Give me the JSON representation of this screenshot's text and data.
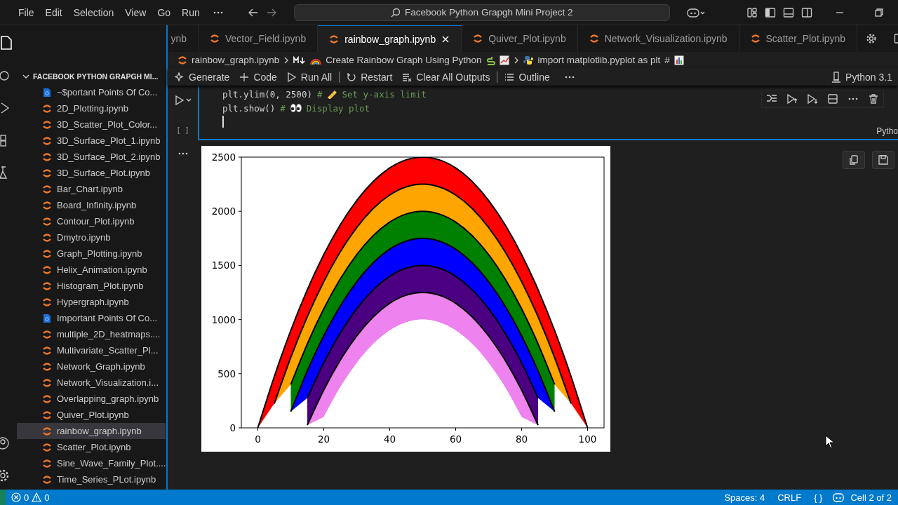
{
  "menu": [
    "File",
    "Edit",
    "Selection",
    "View",
    "Go",
    "Run"
  ],
  "title_search": "Facebook Python Grapgh Mini Project 2",
  "tabs": [
    {
      "label": "ynb",
      "selected": false
    },
    {
      "label": "Vector_Field.ipynb",
      "selected": false
    },
    {
      "label": "rainbow_graph.ipynb",
      "selected": true
    },
    {
      "label": "Quiver_Plot.ipynb",
      "selected": false
    },
    {
      "label": "Network_Visualization.ipynb",
      "selected": false
    },
    {
      "label": "Scatter_Plot.ipynb",
      "selected": false
    }
  ],
  "sidebar": {
    "title": "FACEBOOK PYTHON GRAPGH MI...",
    "items": [
      {
        "name": "~$portant Points Of Co...",
        "kind": "document",
        "selected": false
      },
      {
        "name": "2D_Plotting.ipynb",
        "kind": "notebook",
        "selected": false
      },
      {
        "name": "3D_Scatter_Plot_Color...",
        "kind": "notebook",
        "selected": false
      },
      {
        "name": "3D_Surface_Plot_1.ipynb",
        "kind": "notebook",
        "selected": false
      },
      {
        "name": "3D_Surface_Plot_2.ipynb",
        "kind": "notebook",
        "selected": false
      },
      {
        "name": "3D_Surface_Plot.ipynb",
        "kind": "notebook",
        "selected": false
      },
      {
        "name": "Bar_Chart.ipynb",
        "kind": "notebook",
        "selected": false
      },
      {
        "name": "Board_Infinity.ipynb",
        "kind": "notebook",
        "selected": false
      },
      {
        "name": "Contour_Plot.ipynb",
        "kind": "notebook",
        "selected": false
      },
      {
        "name": "Dmytro.ipynb",
        "kind": "notebook",
        "selected": false
      },
      {
        "name": "Graph_Plotting.ipynb",
        "kind": "notebook",
        "selected": false
      },
      {
        "name": "Helix_Animation.ipynb",
        "kind": "notebook",
        "selected": false
      },
      {
        "name": "Histogram_Plot.ipynb",
        "kind": "notebook",
        "selected": false
      },
      {
        "name": "Hypergraph.ipynb",
        "kind": "notebook",
        "selected": false
      },
      {
        "name": "Important Points Of Co...",
        "kind": "document",
        "selected": false
      },
      {
        "name": "multiple_2D_heatmaps....",
        "kind": "notebook",
        "selected": false
      },
      {
        "name": "Multivariate_Scatter_Pl...",
        "kind": "notebook",
        "selected": false
      },
      {
        "name": "Network_Graph.ipynb",
        "kind": "notebook",
        "selected": false
      },
      {
        "name": "Network_Visualization.i...",
        "kind": "notebook",
        "selected": false
      },
      {
        "name": "Overlapping_graph.ipynb",
        "kind": "notebook",
        "selected": false
      },
      {
        "name": "Quiver_Plot.ipynb",
        "kind": "notebook",
        "selected": false
      },
      {
        "name": "rainbow_graph.ipynb",
        "kind": "notebook",
        "selected": true
      },
      {
        "name": "Scatter_Plot.ipynb",
        "kind": "notebook",
        "selected": false
      },
      {
        "name": "Sine_Wave_Family_Plot....",
        "kind": "notebook",
        "selected": false
      },
      {
        "name": "Time_Series_PLot.ipynb",
        "kind": "notebook",
        "selected": false
      }
    ]
  },
  "breadcrumb": {
    "file": "rainbow_graph.ipynb",
    "cell": "Create Rainbow Graph Using Python",
    "code": "import matplotlib.pyplot as plt",
    "comment_mark": "#"
  },
  "toolbar": {
    "items": [
      "Generate",
      "Code",
      "Run All",
      "Restart",
      "Clear All Outputs",
      "Outline"
    ],
    "kernel": "Python 3.1"
  },
  "cell": {
    "lines": [
      {
        "code": "plt.ylim(0, 2500)",
        "comment_mark": "#",
        "kind": "ruler",
        "comment": "Set y-axis limit"
      },
      {
        "code": "plt.show()",
        "comment_mark": "#",
        "kind": "eyes",
        "comment": "Display plot"
      }
    ],
    "exec_count": "[ ]",
    "language": "Pytho"
  },
  "output": {
    "chart_data": {
      "type": "area",
      "x": [
        0,
        5,
        10,
        15,
        20,
        25,
        30,
        35,
        40,
        45,
        50,
        55,
        60,
        65,
        70,
        75,
        80,
        85,
        90,
        95,
        100
      ],
      "xlim": [
        -5,
        105
      ],
      "ylim": [
        0,
        2500
      ],
      "xticks": [
        0,
        20,
        40,
        60,
        80,
        100
      ],
      "yticks": [
        0,
        500,
        1000,
        1500,
        2000,
        2500
      ],
      "stacked": false,
      "series": [
        {
          "color": "#ff0000",
          "values": [
            0,
            475,
            900,
            1275,
            1600,
            1875,
            2100,
            2275,
            2400,
            2475,
            2500,
            2475,
            2400,
            2275,
            2100,
            1875,
            1600,
            1275,
            900,
            475,
            0
          ]
        },
        {
          "color": "#ffa500",
          "values": [
            null,
            225,
            650,
            1025,
            1350,
            1625,
            1850,
            2025,
            2150,
            2225,
            2250,
            2225,
            2150,
            2025,
            1850,
            1625,
            1350,
            1025,
            650,
            225,
            null
          ]
        },
        {
          "color": "#008000",
          "values": [
            null,
            null,
            400,
            775,
            1100,
            1375,
            1600,
            1775,
            1900,
            1975,
            2000,
            1975,
            1900,
            1775,
            1600,
            1375,
            1100,
            775,
            400,
            null,
            null
          ]
        },
        {
          "color": "#0000ff",
          "values": [
            null,
            null,
            150,
            525,
            850,
            1125,
            1350,
            1525,
            1650,
            1725,
            1750,
            1725,
            1650,
            1525,
            1350,
            1125,
            850,
            525,
            150,
            null,
            null
          ]
        },
        {
          "color": "#4b0082",
          "values": [
            null,
            null,
            null,
            275,
            600,
            875,
            1100,
            1275,
            1400,
            1475,
            1500,
            1475,
            1400,
            1275,
            1100,
            875,
            600,
            275,
            null,
            null,
            null
          ]
        },
        {
          "color": "#ee82ee",
          "values": [
            null,
            null,
            null,
            25,
            350,
            625,
            850,
            1025,
            1150,
            1225,
            1250,
            1225,
            1150,
            1025,
            850,
            625,
            350,
            25,
            null,
            null,
            null
          ]
        },
        {
          "color": "#ffffff",
          "values": [
            null,
            null,
            null,
            null,
            100,
            375,
            600,
            775,
            900,
            975,
            1000,
            975,
            900,
            775,
            600,
            375,
            100,
            null,
            null,
            null,
            null
          ]
        }
      ]
    }
  },
  "status_bar": {
    "errors": "0",
    "warnings": "0",
    "items": [
      "Spaces: 4",
      "CRLF",
      "{ }",
      "Cell 2 of 2"
    ]
  }
}
